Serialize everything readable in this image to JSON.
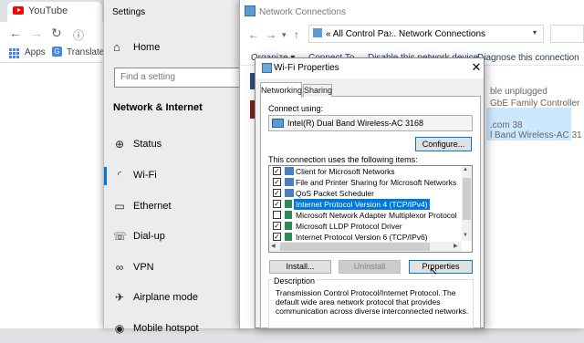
{
  "browser": {
    "tab_title": "YouTube",
    "bookmarks": [
      {
        "label": "Apps"
      },
      {
        "label": "Translate"
      }
    ]
  },
  "settings": {
    "window_title": "Settings",
    "home_label": "Home",
    "search_placeholder": "Find a setting",
    "section_heading": "Network & Internet",
    "nav_items": [
      {
        "label": "Status",
        "icon": "globe-status-icon"
      },
      {
        "label": "Wi-Fi",
        "icon": "wifi-icon",
        "active": true
      },
      {
        "label": "Ethernet",
        "icon": "ethernet-icon"
      },
      {
        "label": "Dial-up",
        "icon": "dialup-icon"
      },
      {
        "label": "VPN",
        "icon": "vpn-icon"
      },
      {
        "label": "Airplane mode",
        "icon": "airplane-icon"
      },
      {
        "label": "Mobile hotspot",
        "icon": "hotspot-icon"
      }
    ]
  },
  "network_connections": {
    "window_title": "Network Connections",
    "address": {
      "prefix": "«",
      "segment1": "All Control Pa...",
      "separator": "›",
      "segment2": "Network Connections"
    },
    "commands": [
      "Organize ▾",
      "Connect To",
      "Disable this network device",
      "Diagnose this connection"
    ],
    "connection1_lines": [
      "ble unplugged",
      "GbE Family Controller"
    ],
    "connection2_lines": [
      ".com 38",
      "l Band Wireless-AC 31"
    ]
  },
  "dialog": {
    "title": "Wi-Fi Properties",
    "tabs": [
      "Networking",
      "Sharing"
    ],
    "connect_using_label": "Connect using:",
    "adapter_name": "Intel(R) Dual Band Wireless-AC 3168",
    "configure_label": "Configure...",
    "items_heading": "This connection uses the following items:",
    "items": [
      {
        "label": "Client for Microsoft Networks",
        "checked": true
      },
      {
        "label": "File and Printer Sharing for Microsoft Networks",
        "checked": true
      },
      {
        "label": "QoS Packet Scheduler",
        "checked": true
      },
      {
        "label": "Internet Protocol Version 4 (TCP/IPv4)",
        "checked": true,
        "selected": true
      },
      {
        "label": "Microsoft Network Adapter Multiplexor Protocol",
        "checked": false
      },
      {
        "label": "Microsoft LLDP Protocol Driver",
        "checked": true
      },
      {
        "label": "Internet Protocol Version 6 (TCP/IPv6)",
        "checked": true
      }
    ],
    "install_label": "Install...",
    "uninstall_label": "Uninstall",
    "properties_label": "Properties",
    "description_title": "Description",
    "description_text": "Transmission Control Protocol/Internet Protocol. The default wide area network protocol that provides communication across diverse interconnected networks."
  }
}
